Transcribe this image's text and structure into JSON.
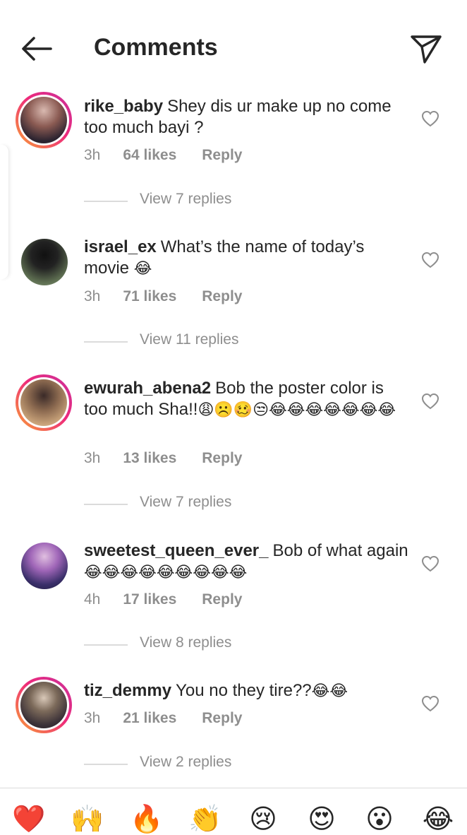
{
  "header": {
    "title": "Comments"
  },
  "comments": [
    {
      "username": "rike_baby",
      "text": "Shey dis ur make up no come too much bayi ?",
      "emojis": "",
      "time": "3h",
      "likes": "64 likes",
      "reply": "Reply",
      "view_replies": "View 7 replies"
    },
    {
      "username": "israel_ex",
      "text": "What’s the name of today’s movie",
      "emojis": "😂",
      "time": "3h",
      "likes": "71 likes",
      "reply": "Reply",
      "view_replies": "View 11 replies"
    },
    {
      "username": "ewurah_abena2",
      "text": "Bob the poster color is too much Sha!!",
      "emojis": "😩☹️🥴😒😂😂😂😂😂😂😂",
      "time": "3h",
      "likes": "13 likes",
      "reply": "Reply",
      "view_replies": "View 7 replies"
    },
    {
      "username": "sweetest_queen_ever_",
      "text": "Bob of what again",
      "emojis": "😂😂😂😂😂😂😂😂😂",
      "time": "4h",
      "likes": "17 likes",
      "reply": "Reply",
      "view_replies": "View 8 replies"
    },
    {
      "username": "tiz_demmy",
      "text": "You no they tire??",
      "emojis": "😂😂",
      "time": "3h",
      "likes": "21 likes",
      "reply": "Reply",
      "view_replies": "View 2 replies"
    }
  ],
  "emoji_bar": [
    "❤️",
    "🙌",
    "🔥",
    "👏",
    "😢",
    "😍",
    "😮",
    "😂"
  ],
  "colors": {
    "text": "#262626",
    "secondary": "#8e8e8e",
    "divider": "#dbdbdb",
    "story_ring_start": "#f9a234",
    "story_ring_end": "#c8309b"
  }
}
